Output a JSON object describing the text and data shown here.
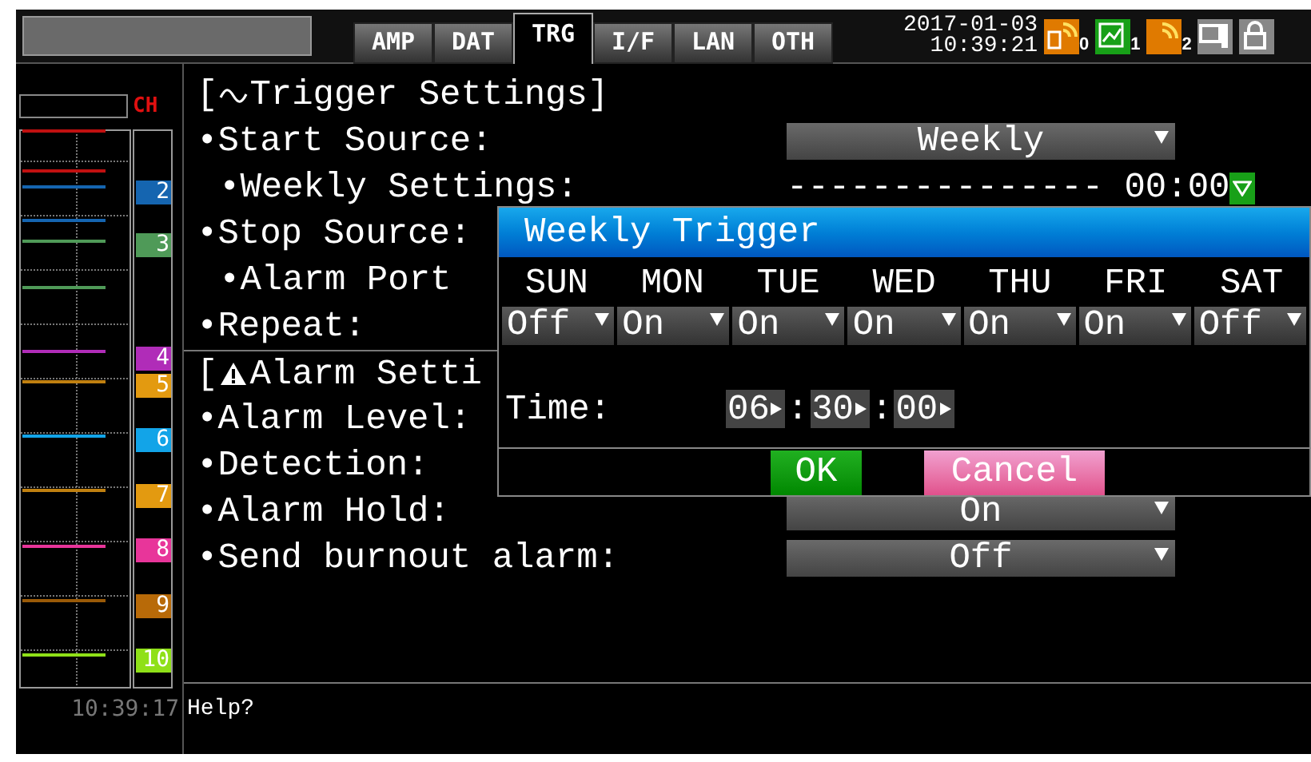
{
  "tabs": [
    {
      "label": "AMP",
      "selected": false
    },
    {
      "label": "DAT",
      "selected": false
    },
    {
      "label": "TRG",
      "selected": true
    },
    {
      "label": "I/F",
      "selected": false
    },
    {
      "label": "LAN",
      "selected": false
    },
    {
      "label": "OTH",
      "selected": false
    }
  ],
  "datetime": {
    "date": "2017-01-03",
    "time": "10:39:21"
  },
  "status_icons": [
    {
      "kind": "card",
      "label": "0"
    },
    {
      "kind": "graph",
      "label": "1"
    },
    {
      "kind": "signal",
      "label": "2"
    },
    {
      "kind": "monitor"
    },
    {
      "kind": "lock"
    }
  ],
  "channel_panel": {
    "header": "CH",
    "time": "10:39:17",
    "channels": [
      {
        "label": "2",
        "color": "#1565b0"
      },
      {
        "label": "3",
        "color": "#4f9a58"
      },
      {
        "label": "4",
        "color": "#b02cb8"
      },
      {
        "label": "5",
        "color": "#e39a10"
      },
      {
        "label": "6",
        "color": "#12a4e8"
      },
      {
        "label": "7",
        "color": "#e39a10"
      },
      {
        "label": "8",
        "color": "#e8359a"
      },
      {
        "label": "9",
        "color": "#b86a08"
      },
      {
        "label": "10",
        "color": "#8fe018"
      }
    ]
  },
  "sections": [
    {
      "kind": "trigger",
      "title_prefix": "[",
      "title": "Trigger Settings",
      "title_suffix": "]",
      "rows": [
        {
          "label": "•Start Source:",
          "kind": "dropdown",
          "value": "Weekly",
          "children": [
            {
              "label": "•Weekly Settings:",
              "kind": "schedule",
              "value": "--------------- 00:00"
            }
          ]
        },
        {
          "label": "•Stop Source:",
          "kind": "plain",
          "children": [
            {
              "label": "•Alarm Port",
              "kind": "plain"
            }
          ]
        },
        {
          "label": "•Repeat:",
          "kind": "plain"
        }
      ]
    },
    {
      "kind": "alarm",
      "title_prefix": "[",
      "title": "Alarm Setti",
      "rows": [
        {
          "label": "•Alarm Level:",
          "kind": "plain"
        },
        {
          "label": "•Detection:",
          "kind": "plain"
        },
        {
          "label": "•Alarm Hold:",
          "kind": "dropdown",
          "value": "On"
        },
        {
          "label": "•Send burnout alarm:",
          "kind": "dropdown",
          "value": "Off"
        }
      ]
    }
  ],
  "dialog": {
    "title": "Weekly Trigger",
    "days": [
      {
        "name": "SUN",
        "value": "Off"
      },
      {
        "name": "MON",
        "value": "On"
      },
      {
        "name": "TUE",
        "value": "On"
      },
      {
        "name": "WED",
        "value": "On"
      },
      {
        "name": "THU",
        "value": "On"
      },
      {
        "name": "FRI",
        "value": "On"
      },
      {
        "name": "SAT",
        "value": "Off"
      }
    ],
    "time_label": "Time:",
    "time": [
      {
        "value": "06"
      },
      {
        "prefix": ":",
        "value": "30"
      },
      {
        "prefix": ":",
        "value": "00"
      }
    ],
    "buttons": [
      {
        "label": "OK",
        "kind": "ok"
      },
      {
        "label": "Cancel",
        "kind": "cancel"
      }
    ]
  },
  "help": {
    "text": "Help?"
  }
}
